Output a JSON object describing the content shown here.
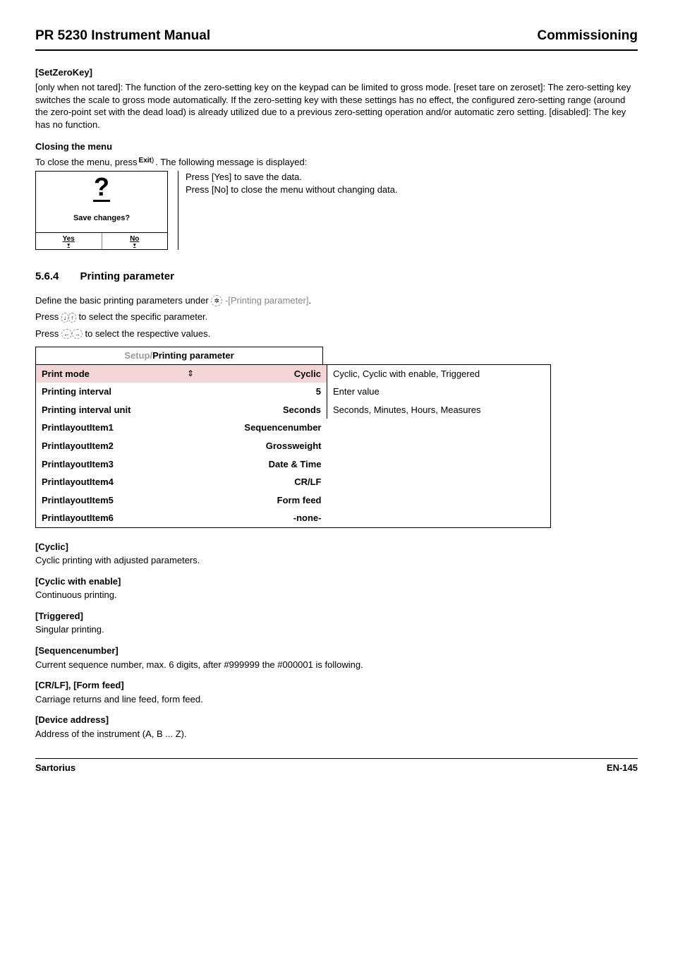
{
  "header": {
    "left": "PR 5230 Instrument Manual",
    "right": "Commissioning"
  },
  "setzero": {
    "title": "[SetZeroKey]",
    "body": "[only when not tared]: The function of the zero-setting key on the keypad can be limited to gross mode.  [reset tare on zeroset]: The zero-setting key switches the scale to gross mode automatically. If the zero-setting key with these settings has no effect, the configured zero-setting range (around the zero-point set with the dead load) is already utilized due to a previous zero-setting operation and/or automatic zero setting. [disabled]: The key has no function."
  },
  "closing": {
    "title": "Closing the menu",
    "line_pre": "To close the menu, press ",
    "exit_label": "Exit",
    "line_post": ". The following message is displayed:",
    "lcd_save": "Save changes?",
    "lcd_yes": "Yes",
    "lcd_no": "No",
    "press_yes": "Press [Yes] to save the data.",
    "press_no": "Press [No] to close the menu without changing data."
  },
  "section": {
    "num": "5.6.4",
    "title": "Printing parameter",
    "intro_pre": "Define the basic printing parameters under ",
    "intro_link": "-[Printing parameter]",
    "press1_pre": "Press ",
    "press1_post": " to select the specific parameter.",
    "press2_pre": "Press ",
    "press2_post": " to select the respective values."
  },
  "table": {
    "header_grey": "Setup/",
    "header_bold": "Printing parameter",
    "rows": [
      {
        "label": "Print mode",
        "value": "Cyclic",
        "note": "Cyclic, Cyclic with enable, Triggered",
        "hl": true,
        "updown": true
      },
      {
        "label": "Printing interval",
        "value": "5",
        "note": "Enter value"
      },
      {
        "label": "Printing interval unit",
        "value": "Seconds",
        "note": "Seconds, Minutes, Hours, Measures"
      },
      {
        "label": "PrintlayoutItem1",
        "value": "Sequencenumber",
        "note": ""
      },
      {
        "label": "PrintlayoutItem2",
        "value": "Grossweight",
        "note": ""
      },
      {
        "label": "PrintlayoutItem3",
        "value": "Date & Time",
        "note": ""
      },
      {
        "label": "PrintlayoutItem4",
        "value": "CR/LF",
        "note": ""
      },
      {
        "label": "PrintlayoutItem5",
        "value": "Form feed",
        "note": ""
      },
      {
        "label": "PrintlayoutItem6",
        "value": "-none-",
        "note": ""
      }
    ]
  },
  "defs": [
    {
      "title": "[Cyclic]",
      "body": "Cyclic printing with adjusted parameters."
    },
    {
      "title": "[Cyclic with enable]",
      "body": "Continuous printing."
    },
    {
      "title": "[Triggered]",
      "body": "Singular printing."
    },
    {
      "title": "[Sequencenumber]",
      "body": "Current sequence number, max. 6 digits, after #999999 the #000001 is following."
    },
    {
      "title": "[CR/LF], [Form feed]",
      "body": "Carriage returns and line feed, form feed."
    },
    {
      "title": "[Device address]",
      "body": "Address of the instrument (A, B ... Z)."
    }
  ],
  "footer": {
    "left": "Sartorius",
    "right": "EN-145"
  }
}
